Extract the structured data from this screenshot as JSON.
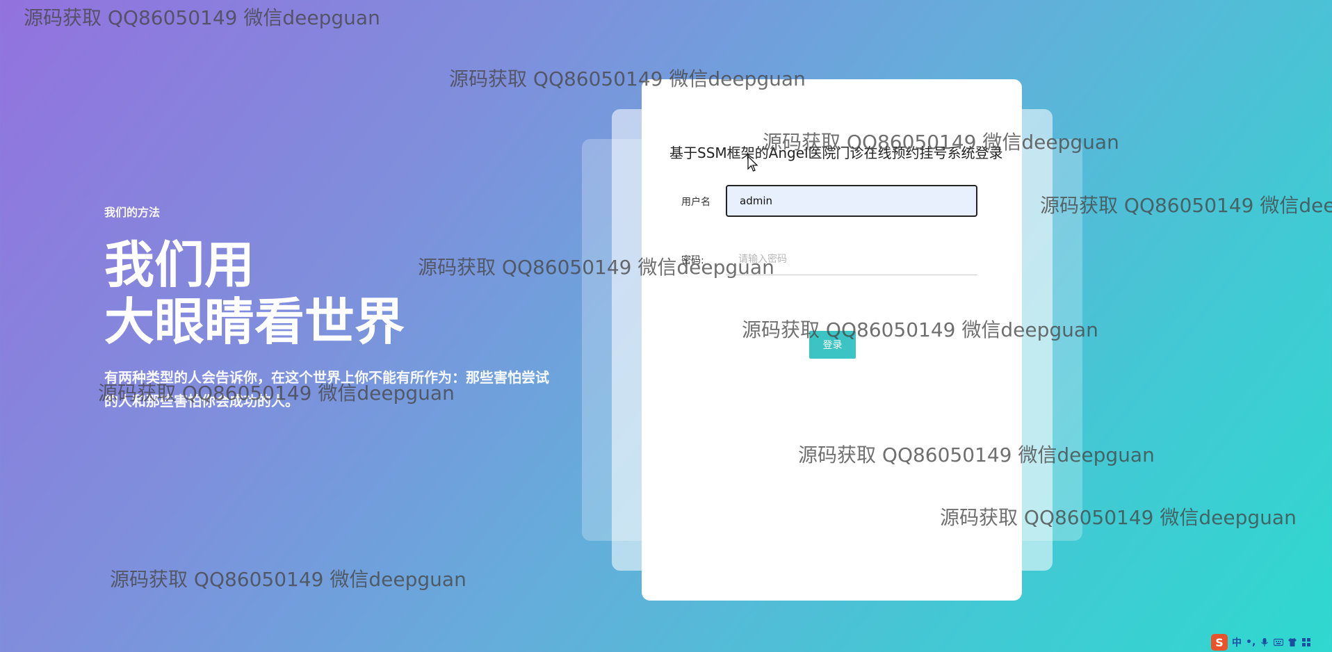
{
  "hero": {
    "eyebrow": "我们的方法",
    "title_line1": "我们用",
    "title_line2": "大眼睛看世界",
    "description": "有两种类型的人会告诉你，在这个世界上你不能有所作为：那些害怕尝试的人和那些害怕你会成功的人。"
  },
  "login": {
    "title": "基于SSM框架的Angel医院门诊在线预约挂号系统登录",
    "username_label": "用户名",
    "username_value": "admin",
    "password_label": "密码:",
    "password_placeholder": "请输入密码",
    "submit_label": "登录"
  },
  "watermark_text": "源码获取 QQ86050149 微信deepguan",
  "ime": {
    "logo": "S",
    "lang": "中",
    "punct": "•,"
  },
  "colors": {
    "gradient_start": "#9372de",
    "gradient_end": "#2fd8cf",
    "button": "#3cc3c3",
    "input_bg": "#e8f0fe"
  },
  "icons": [
    "cursor-icon",
    "microphone-icon",
    "keyboard-icon",
    "shirt-icon",
    "grid-icon"
  ]
}
